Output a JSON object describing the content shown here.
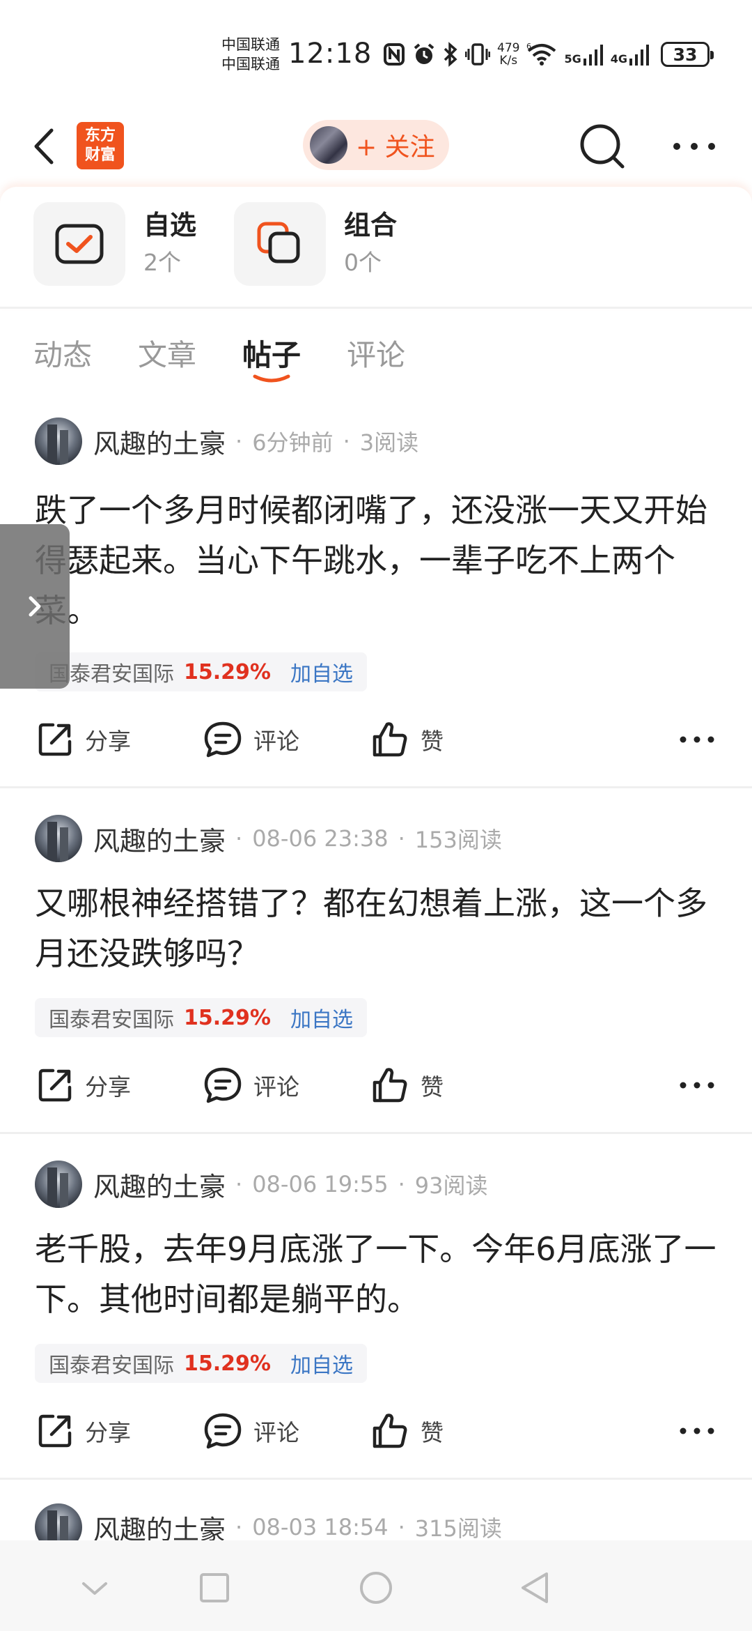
{
  "status_bar": {
    "carrier_1": "中国联通",
    "carrier_2": "中国联通",
    "time": "12:18",
    "net_speed_value": "479",
    "net_speed_unit": "K/s",
    "signal_1": "5G",
    "signal_2": "4G",
    "battery": "33"
  },
  "header": {
    "logo_line1": "东方",
    "logo_line2": "财富",
    "follow_label": "+ 关注"
  },
  "cards": [
    {
      "title": "自选",
      "count": "2个"
    },
    {
      "title": "组合",
      "count": "0个"
    }
  ],
  "tabs": [
    {
      "label": "动态"
    },
    {
      "label": "文章"
    },
    {
      "label": "帖子"
    },
    {
      "label": "评论"
    }
  ],
  "posts": [
    {
      "author": "风趣的土豪",
      "time": "6分钟前",
      "reads": "3阅读",
      "body": "跌了一个多月时候都闭嘴了，还没涨一天又开始得瑟起来。当心下午跳水，一辈子吃不上两个菜。",
      "stock_name": "国泰君安国际",
      "stock_change": "15.29%",
      "add_label": "加自选"
    },
    {
      "author": "风趣的土豪",
      "time": "08-06 23:38",
      "reads": "153阅读",
      "body": "又哪根神经搭错了？都在幻想着上涨，这一个多月还没跌够吗？",
      "stock_name": "国泰君安国际",
      "stock_change": "15.29%",
      "add_label": "加自选"
    },
    {
      "author": "风趣的土豪",
      "time": "08-06 19:55",
      "reads": "93阅读",
      "body": "老千股，去年9月底涨了一下。今年6月底涨了一下。其他时间都是躺平的。",
      "stock_name": "国泰君安国际",
      "stock_change": "15.29%",
      "add_label": "加自选"
    },
    {
      "author": "风趣的土豪",
      "time": "08-03 18:54",
      "reads": "315阅读"
    }
  ],
  "actions": {
    "share": "分享",
    "comment": "评论",
    "like": "赞"
  },
  "colors": {
    "brand": "#f0531e",
    "stock_up": "#e0311f",
    "link": "#3b76c4"
  }
}
